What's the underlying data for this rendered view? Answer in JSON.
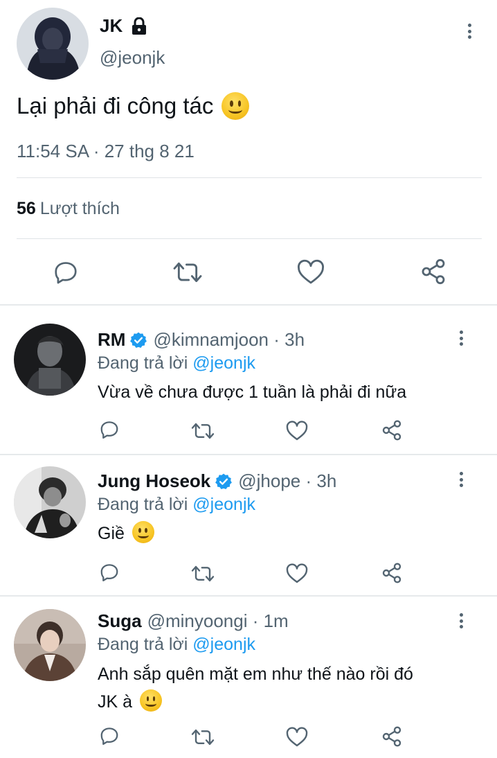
{
  "main_tweet": {
    "name": "JK",
    "handle": "@jeonjk",
    "text": "Lại phải đi công tác",
    "emoji": "slightly-smiling-face",
    "timestamp": "11:54 SA · 27 thg 8 21",
    "likes_count": "56",
    "likes_label": "Lượt thích"
  },
  "replies": [
    {
      "name": "RM",
      "verified": true,
      "handle": "@kimnamjoon · 3h",
      "replying_label": "Đang trả lời",
      "replying_to": "@jeonjk",
      "text": "Vừa về chưa được 1 tuần là phải đi nữa"
    },
    {
      "name": "Jung Hoseok",
      "verified": true,
      "handle": "@jhope · 3h",
      "replying_label": "Đang trả lời",
      "replying_to": "@jeonjk",
      "text": "Giề",
      "emoji": "slightly-smiling-face"
    },
    {
      "name": "Suga",
      "verified": false,
      "handle": "@minyoongi · 1m",
      "replying_label": "Đang trả lời",
      "replying_to": "@jeonjk",
      "text_line1": "Anh sắp quên mặt em như thế nào rồi đó",
      "text_line2": "JK à",
      "emoji": "slightly-smiling-face"
    }
  ],
  "icons": {
    "reply": "reply-icon",
    "retweet": "retweet-icon",
    "like": "heart-icon",
    "share": "share-icon",
    "more": "more-vertical-icon",
    "lock": "lock-icon",
    "verified": "verified-badge-icon"
  },
  "colors": {
    "accent": "#1d9bf0",
    "secondary_text": "#536471",
    "primary_text": "#0f1419",
    "divider": "#dfe3e6"
  }
}
